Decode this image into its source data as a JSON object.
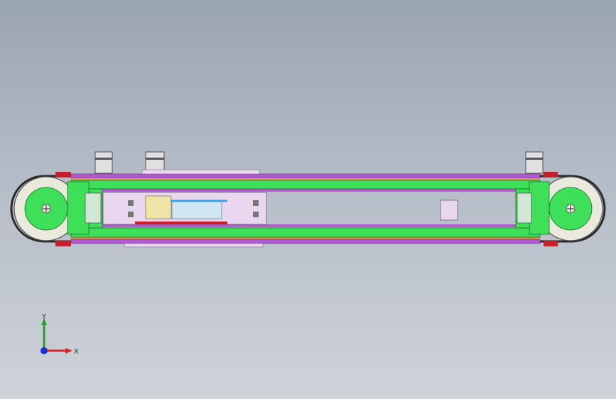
{
  "viewport": {
    "background_top": "#9aa5b2",
    "background_bottom": "#cfd3d9"
  },
  "triad": {
    "x_label": "X",
    "y_label": "Y",
    "x_color": "#d9262a",
    "y_color": "#2a9b33",
    "z_color": "#1c2fd1"
  },
  "model_colors": {
    "frame_green": "#3ee05a",
    "rail_purple": "#b35ad1",
    "rail_orange": "#e59a3c",
    "pulley_face": "#e9e9dc",
    "belt_dark": "#2a2a2a",
    "mount_pink": "#e8d7ee",
    "accent_red": "#c8202a"
  }
}
